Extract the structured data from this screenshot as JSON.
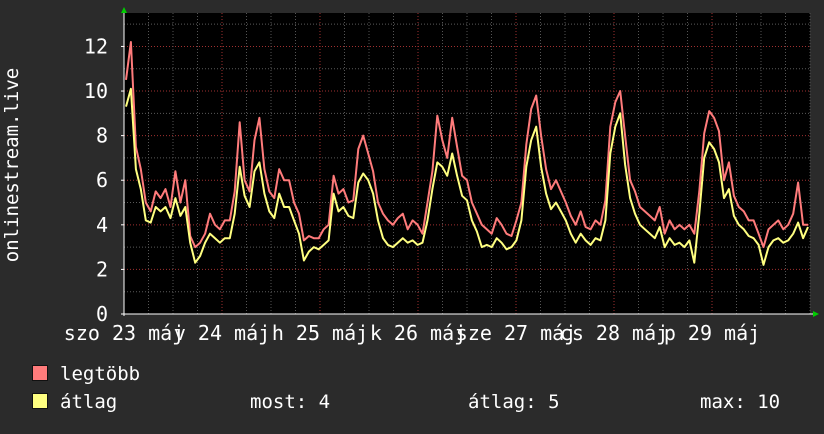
{
  "chart_data": {
    "type": "line",
    "ylabel": "onlinestream.live",
    "ylim": [
      0,
      13.5
    ],
    "y_ticks": [
      "0",
      "2",
      "4",
      "6",
      "8",
      "10",
      "12"
    ],
    "x_tick_labels": [
      "szo 23 máj",
      "v 24 máj",
      "h 25 máj",
      "k 26 máj",
      "sze 27 máj",
      "cs 28 máj",
      "p 29 máj"
    ],
    "grid": true,
    "series": [
      {
        "name": "legtöbb",
        "color": "#ff7b7b",
        "values": [
          10.5,
          12.2,
          7.5,
          6.5,
          5.0,
          4.6,
          5.5,
          5.2,
          5.6,
          4.8,
          6.4,
          5.0,
          6.0,
          3.5,
          3.0,
          3.2,
          3.6,
          4.5,
          4.0,
          3.8,
          4.2,
          4.2,
          5.5,
          8.6,
          6.0,
          5.5,
          7.8,
          8.8,
          6.5,
          5.5,
          5.2,
          6.5,
          6.0,
          6.0,
          5.0,
          4.5,
          3.3,
          3.5,
          3.4,
          3.4,
          3.8,
          4.0,
          6.2,
          5.4,
          5.6,
          5.0,
          5.1,
          7.4,
          8.0,
          7.2,
          6.4,
          5.0,
          4.5,
          4.2,
          4.0,
          4.3,
          4.5,
          3.8,
          4.2,
          4.0,
          3.6,
          5.0,
          6.4,
          8.9,
          7.8,
          7.0,
          8.8,
          7.5,
          6.2,
          6.0,
          5.0,
          4.5,
          4.0,
          3.8,
          3.6,
          4.3,
          4.0,
          3.6,
          3.5,
          4.2,
          5.0,
          7.6,
          9.2,
          9.8,
          8.0,
          6.5,
          5.6,
          6.0,
          5.5,
          5.0,
          4.4,
          4.0,
          4.6,
          3.9,
          3.8,
          4.2,
          4.0,
          5.1,
          8.4,
          9.5,
          10.0,
          8.0,
          6.0,
          5.5,
          4.8,
          4.6,
          4.4,
          4.2,
          4.8,
          3.6,
          4.2,
          3.8,
          4.0,
          3.8,
          4.0,
          3.6,
          5.5,
          8.1,
          9.1,
          8.8,
          8.2,
          6.0,
          6.8,
          5.3,
          4.8,
          4.6,
          4.2,
          4.2,
          3.6,
          3.0,
          3.8,
          4.0,
          4.2,
          3.8,
          4.0,
          4.5,
          5.9,
          4.0,
          4.0
        ]
      },
      {
        "name": "átlag",
        "color": "#ffff80",
        "values": [
          9.3,
          10.1,
          6.5,
          5.6,
          4.2,
          4.1,
          4.8,
          4.6,
          4.8,
          4.3,
          5.2,
          4.4,
          4.8,
          3.2,
          2.3,
          2.6,
          3.2,
          3.6,
          3.4,
          3.2,
          3.4,
          3.4,
          4.5,
          6.6,
          5.3,
          4.8,
          6.4,
          6.8,
          5.4,
          4.6,
          4.3,
          5.4,
          4.8,
          4.8,
          4.2,
          3.6,
          2.4,
          2.8,
          3.0,
          2.9,
          3.1,
          3.3,
          5.4,
          4.6,
          4.8,
          4.4,
          4.3,
          5.9,
          6.3,
          6.0,
          5.4,
          4.2,
          3.4,
          3.1,
          3.0,
          3.2,
          3.4,
          3.2,
          3.3,
          3.1,
          3.2,
          4.2,
          5.6,
          6.8,
          6.6,
          6.2,
          7.2,
          6.2,
          5.3,
          5.1,
          4.2,
          3.7,
          3.0,
          3.1,
          3.0,
          3.4,
          3.2,
          2.9,
          3.0,
          3.3,
          4.2,
          6.6,
          7.8,
          8.4,
          6.6,
          5.4,
          4.7,
          5.0,
          4.6,
          4.2,
          3.6,
          3.2,
          3.6,
          3.3,
          3.1,
          3.4,
          3.3,
          4.2,
          7.2,
          8.4,
          9.0,
          6.7,
          5.2,
          4.5,
          4.0,
          3.8,
          3.6,
          3.4,
          3.9,
          3.0,
          3.4,
          3.1,
          3.2,
          3.0,
          3.3,
          2.3,
          4.5,
          7.0,
          7.7,
          7.4,
          6.8,
          5.2,
          5.6,
          4.4,
          4.0,
          3.8,
          3.5,
          3.4,
          3.1,
          2.2,
          3.0,
          3.3,
          3.4,
          3.2,
          3.3,
          3.6,
          4.1,
          3.4,
          3.9
        ]
      }
    ]
  },
  "legend": {
    "items": [
      {
        "label": "legtöbb",
        "color": "#ff7b7b"
      },
      {
        "label": "átlag",
        "color": "#ffff80"
      }
    ]
  },
  "stats": {
    "now_label": "most:",
    "now_value": "4",
    "avg_label": "átlag:",
    "avg_value": "5",
    "max_label": "max:",
    "max_value": "10"
  }
}
